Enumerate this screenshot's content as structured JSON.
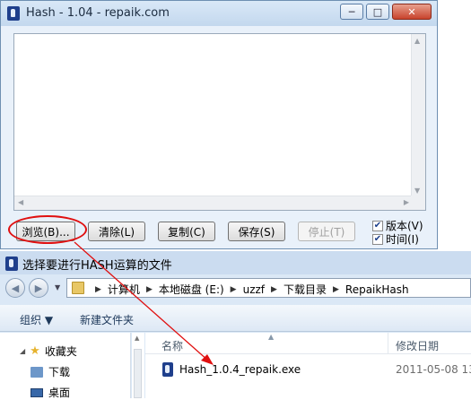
{
  "hash_window": {
    "title": "Hash - 1.04 - repaik.com",
    "caption": {
      "minimize": "─",
      "maximize": "□",
      "close": "✕"
    },
    "buttons": {
      "browse": "浏览(B)...",
      "clear": "清除(L)",
      "copy": "复制(C)",
      "save": "保存(S)",
      "stop": "停止(T)"
    },
    "options": {
      "version": {
        "label": "版本(V)",
        "checked": true
      },
      "time": {
        "label": "时间(I)",
        "checked": true
      }
    }
  },
  "dialog": {
    "title": "选择要进行HASH运算的文件",
    "breadcrumb": [
      "计算机",
      "本地磁盘 (E:)",
      "uzzf",
      "下载目录",
      "RepaikHash"
    ],
    "toolbar": {
      "organize": "组织 ▼",
      "new_folder": "新建文件夹"
    },
    "nav": {
      "favorites": "收藏夹",
      "downloads": "下载",
      "desktop": "桌面"
    },
    "columns": {
      "name": "名称",
      "date": "修改日期"
    },
    "files": [
      {
        "name": "Hash_1.0.4_repaik.exe",
        "date": "2011-05-08 13"
      }
    ]
  },
  "colors": {
    "annotation": "#e01010",
    "title_bar": "#c3d8ee"
  }
}
